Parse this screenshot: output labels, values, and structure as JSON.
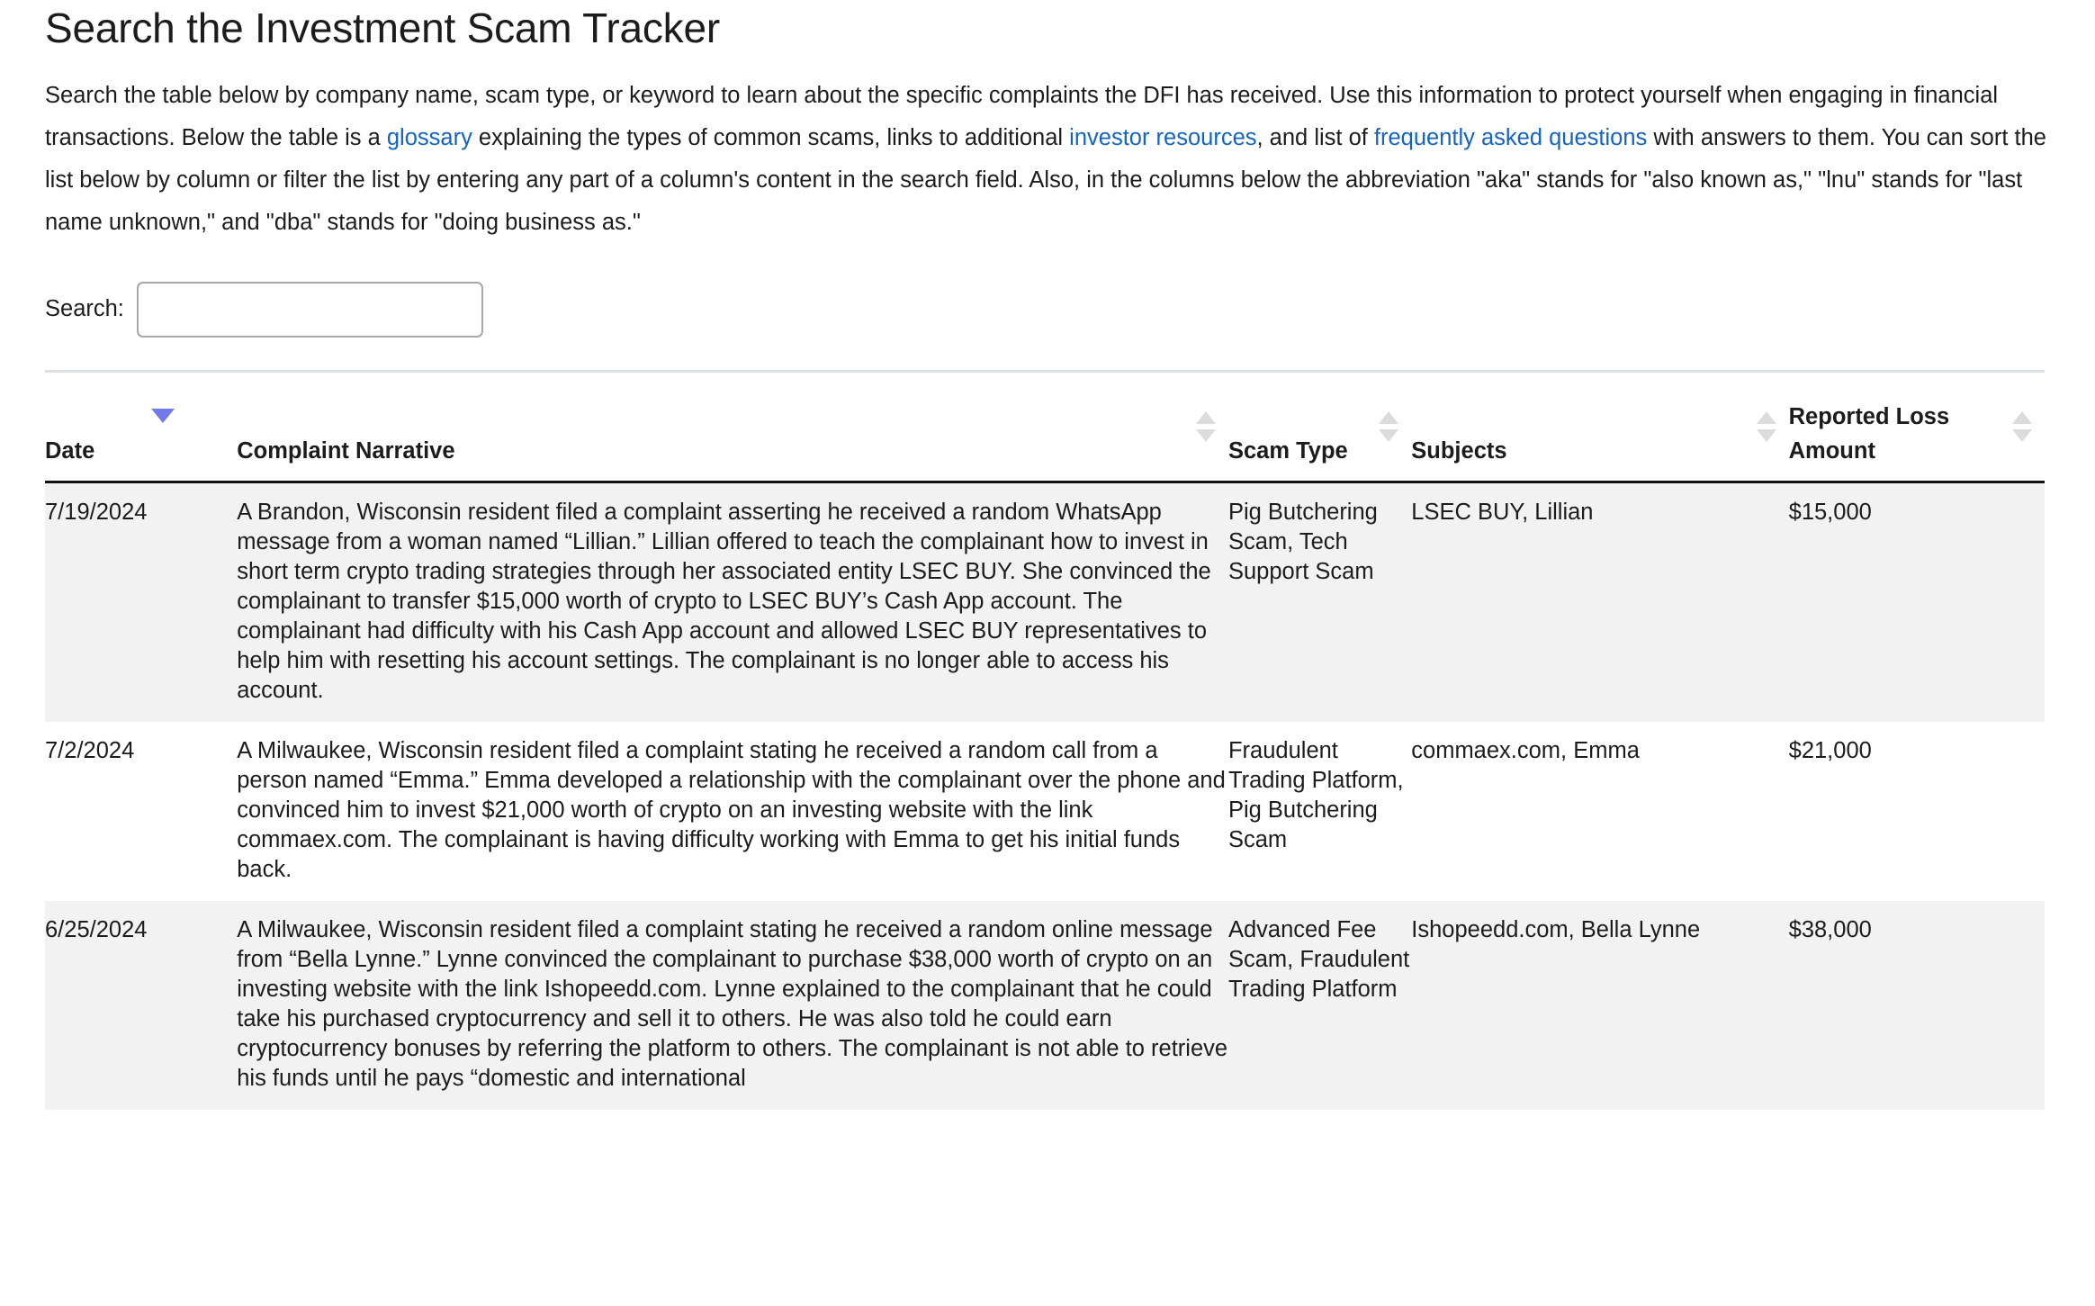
{
  "page": {
    "title": "Search the Investment Scam Tracker",
    "intro": {
      "part1": "Search the table below by company name, scam type, or keyword to learn about the specific complaints the DFI has received. Use this information to protect yourself when engaging in financial transactions. Below the table is a ",
      "link1": "glossary",
      "part2": " explaining the types of common scams, links to additional ",
      "link2": "investor resources",
      "part3": ", and list of ",
      "link3": "frequently asked questions",
      "part4": " with answers to them. You can sort the list below by column or filter the list by entering any part of a column's content in the search field. Also, in the columns below the abbreviation \"aka\" stands for \"also known as,\" \"lnu\" stands for \"last name unknown,\" and \"dba\" stands for \"doing business as.\""
    }
  },
  "search": {
    "label": "Search:",
    "value": "",
    "placeholder": ""
  },
  "colors": {
    "link": "#1464c0",
    "sort_active": "#7279e8",
    "sort_inactive": "#dcdcdc",
    "row_stripe": "#f2f2f2",
    "header_rule": "#111111",
    "table_top_rule": "#dde1e6"
  },
  "table": {
    "columns": [
      {
        "label": "Date",
        "sort": "desc",
        "icon": "sort-descending-icon"
      },
      {
        "label": "Complaint Narrative",
        "sort": "none",
        "icon": "sort-both-icon"
      },
      {
        "label": "Scam Type",
        "sort": "none",
        "icon": "sort-both-icon"
      },
      {
        "label": "Subjects",
        "sort": "none",
        "icon": "sort-both-icon"
      },
      {
        "label": "Reported Loss Amount",
        "sort": "none",
        "icon": "sort-both-icon"
      }
    ],
    "rows": [
      {
        "date": "7/19/2024",
        "narrative": "A Brandon, Wisconsin resident filed a complaint asserting he received a random WhatsApp message from a  woman named “Lillian.” Lillian offered to teach the complainant how to invest in short term crypto trading strategies through her associated entity LSEC BUY. She convinced the complainant to transfer $15,000 worth of crypto to LSEC BUY’s Cash App account.  The complainant had difficulty with his Cash App account and allowed LSEC BUY representatives to help him with resetting his account settings. The complainant is no longer able to access his account.",
        "scam_type": "Pig Butchering Scam, Tech Support Scam",
        "subjects": "LSEC BUY, Lillian",
        "loss_amount": "$15,000"
      },
      {
        "date": "7/2/2024",
        "narrative": "A Milwaukee, Wisconsin resident filed a complaint stating he received a random call from a person named “Emma.” Emma developed a relationship with the complainant over the phone and convinced him to invest $21,000 worth of crypto on an investing website with the link commaex.com.  The complainant is having difficulty working with Emma to get his initial funds back.",
        "scam_type": "Fraudulent Trading Platform, Pig Butchering Scam",
        "subjects": "commaex.com, Emma",
        "loss_amount": "$21,000"
      },
      {
        "date": "6/25/2024",
        "narrative": "A Milwaukee, Wisconsin resident filed a complaint stating he received a random online message from “Bella Lynne.” Lynne convinced the complainant to purchase $38,000 worth of crypto on an investing website with the link Ishopeedd.com. Lynne explained to the complainant that he could take his purchased cryptocurrency and sell it to others. He was also told he could earn cryptocurrency bonuses by referring the platform to others.  The complainant is not able to retrieve his funds until he pays “domestic and international",
        "scam_type": "Advanced Fee Scam, Fraudulent Trading Platform",
        "subjects": "Ishopeedd.com, Bella Lynne",
        "loss_amount": "$38,000"
      }
    ]
  }
}
